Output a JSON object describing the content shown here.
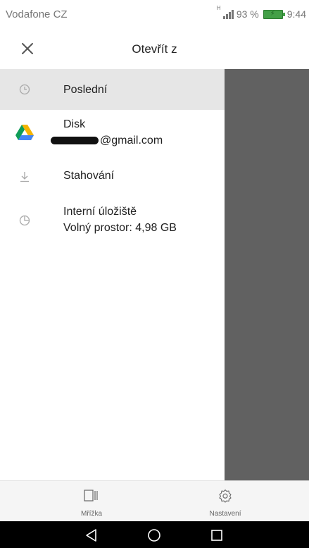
{
  "status_bar": {
    "carrier": "Vodafone CZ",
    "network": "H",
    "battery": "93 %",
    "time": "9:44"
  },
  "app_bar": {
    "title": "Otevřít z",
    "close_icon": "close-icon"
  },
  "drawer": {
    "items": [
      {
        "icon": "clock-icon",
        "label": "Poslední",
        "selected": true
      },
      {
        "icon": "drive-icon",
        "label": "Disk",
        "sublabel": "@gmail.com"
      },
      {
        "icon": "download-icon",
        "label": "Stahování"
      },
      {
        "icon": "storage-icon",
        "label": "Interní úložiště",
        "sublabel": "Volný prostor: 4,98 GB"
      }
    ]
  },
  "bottom_bar": {
    "grid_label": "Mřížka",
    "settings_label": "Nastavení"
  },
  "colors": {
    "scrim": "#616161",
    "selected_row": "#e6e6e6",
    "drive_green": "#0f9d58",
    "drive_yellow": "#f4b400",
    "drive_blue": "#4285f4"
  }
}
